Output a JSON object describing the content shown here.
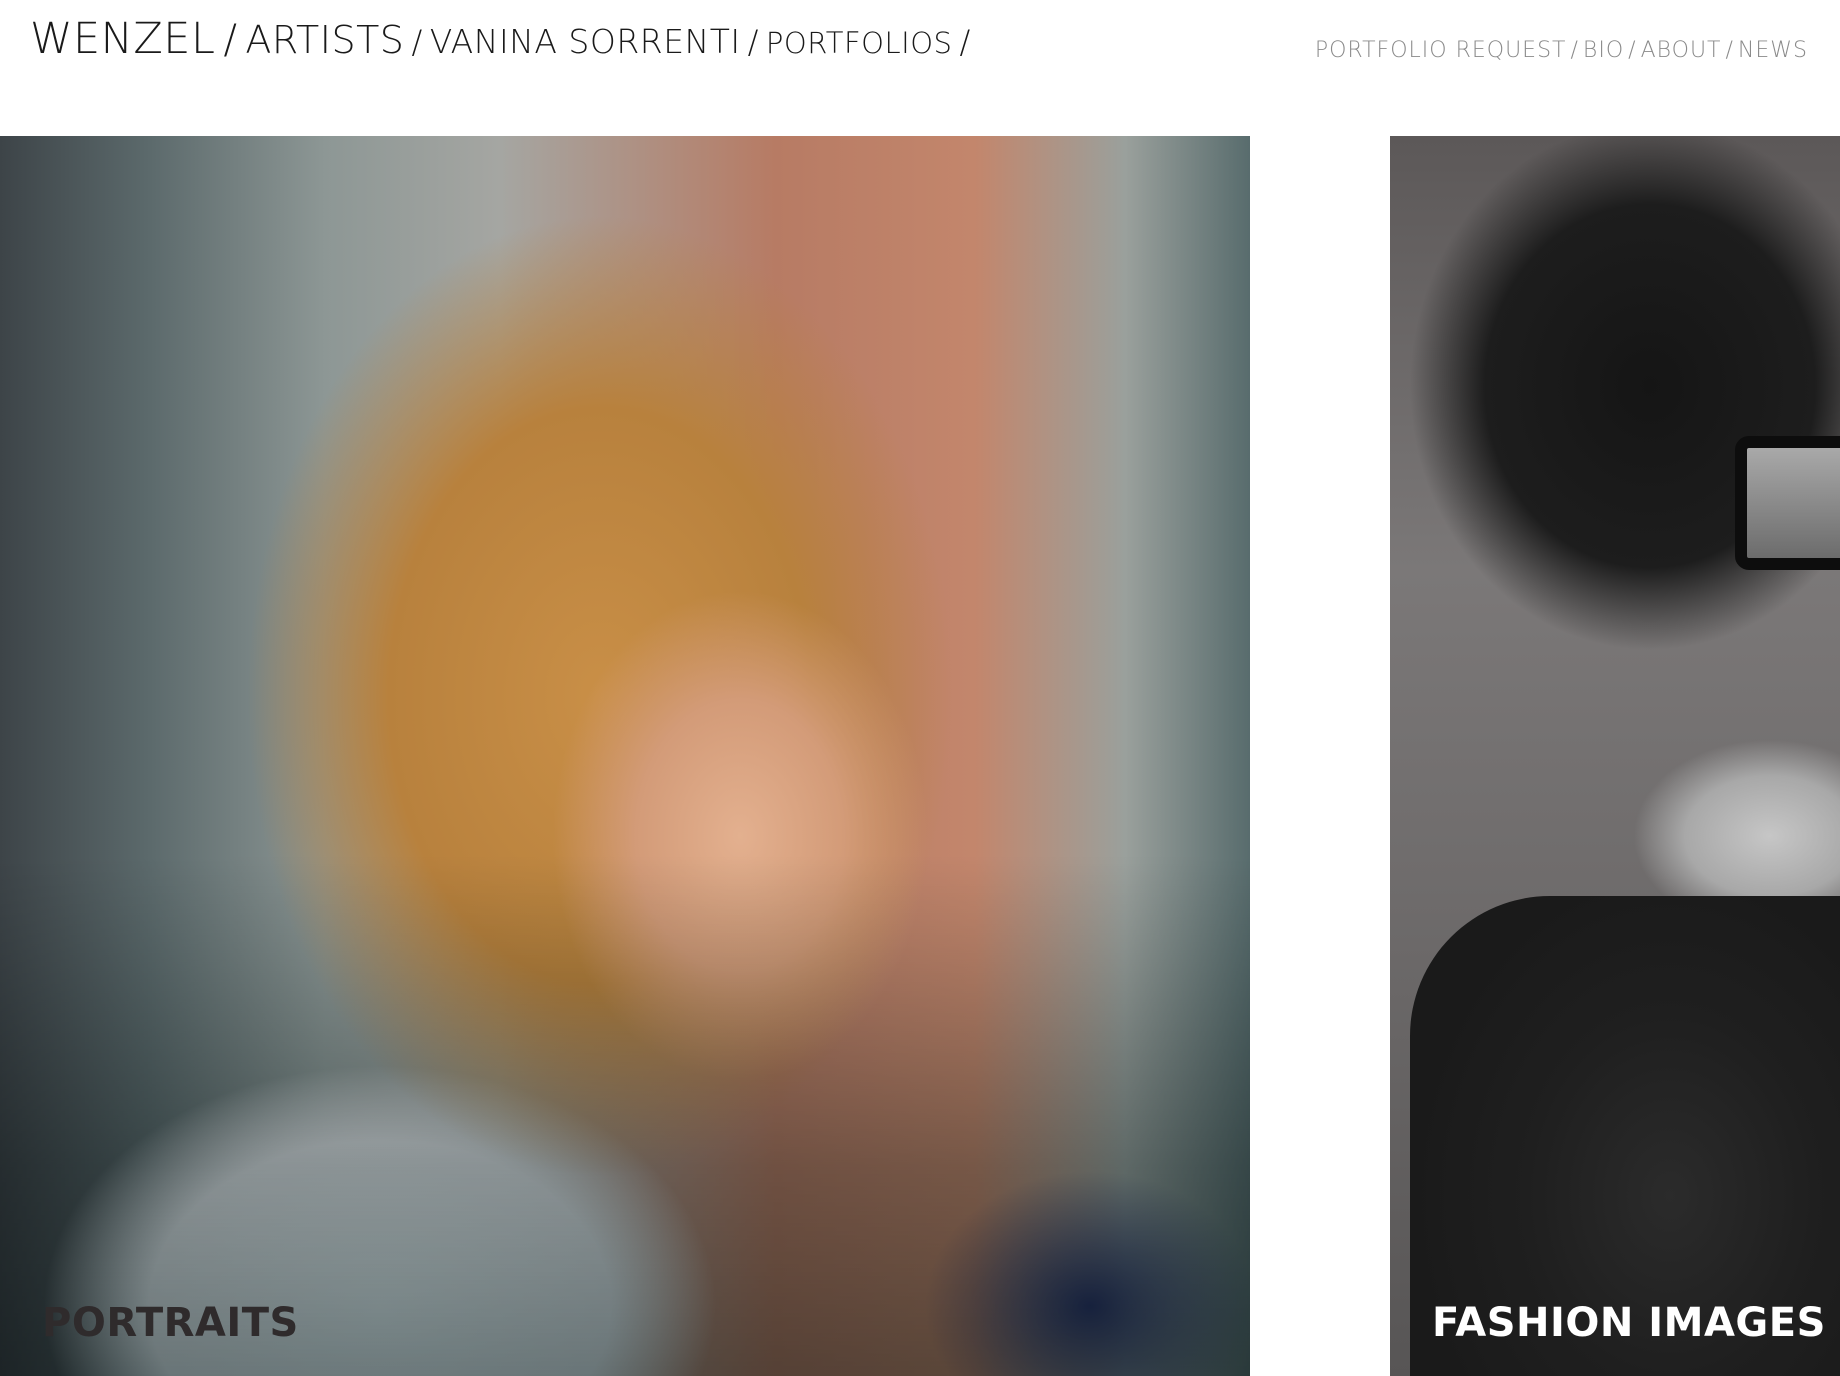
{
  "header": {
    "breadcrumb": {
      "brand": "WENZEL",
      "artists": "ARTISTS",
      "artist": "VANINA SORRENTI",
      "current": "PORTFOLIOS",
      "separator": "/"
    },
    "nav": {
      "items": [
        "PORTFOLIO REQUEST",
        "BIO",
        "ABOUT",
        "NEWS"
      ],
      "separator": "/"
    }
  },
  "tiles": [
    {
      "label": "PORTRAITS"
    },
    {
      "label": "FASHION IMAGES"
    }
  ],
  "colors": {
    "breadcrumb_text": "#1a1a1a",
    "nav_text": "#8a8a8a",
    "background": "#ffffff"
  }
}
